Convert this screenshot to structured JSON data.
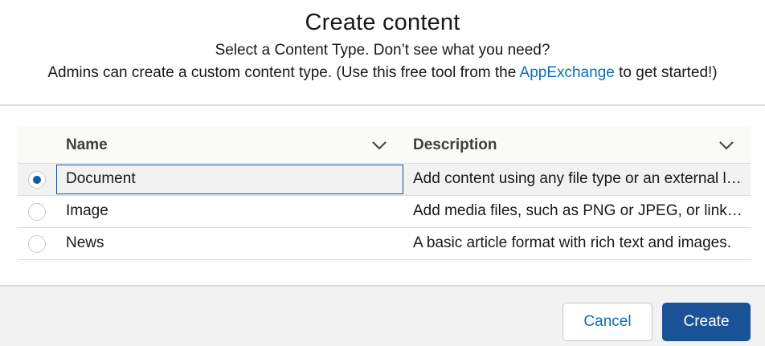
{
  "dialog": {
    "title": "Create content",
    "subtitle_line1": "Select a Content Type. Don’t see what you need?",
    "subtitle_line2_before": "Admins can create a custom content type. (Use this free tool from the ",
    "subtitle_link": "AppExchange",
    "subtitle_line2_after": " to get started!)"
  },
  "table": {
    "columns": [
      {
        "label": "Name",
        "icon": "chevron-down-icon"
      },
      {
        "label": "Description",
        "icon": "chevron-down-icon"
      }
    ],
    "rows": [
      {
        "name": "Document",
        "description": "Add content using any file type or an external link.",
        "selected": true
      },
      {
        "name": "Image",
        "description": "Add media files, such as PNG or JPEG, or link to images.",
        "selected": false
      },
      {
        "name": "News",
        "description": "A basic article format with rich text and images.",
        "selected": false
      }
    ]
  },
  "footer": {
    "cancel_label": "Cancel",
    "create_label": "Create"
  },
  "colors": {
    "brand": "#1b5297",
    "link": "#0b70b5",
    "border": "#dddbda"
  }
}
